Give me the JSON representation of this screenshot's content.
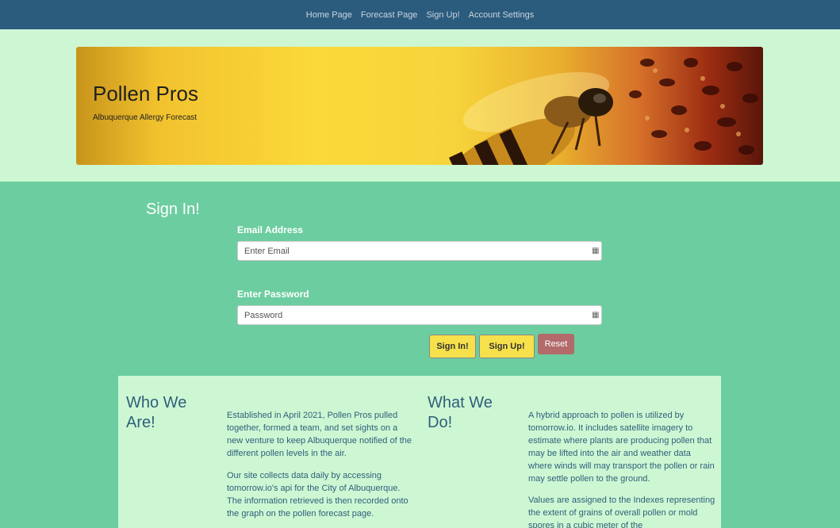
{
  "nav": {
    "home": "Home Page",
    "forecast": "Forecast Page",
    "signup": "Sign Up!",
    "account": "Account Settings"
  },
  "banner": {
    "title": "Pollen Pros",
    "subtitle": "Albuquerque Allergy Forecast"
  },
  "signin": {
    "heading": "Sign In!",
    "email_label": "Email Address",
    "email_placeholder": "Enter Email",
    "password_label": "Enter Password",
    "password_placeholder": "Password",
    "signin_button": "Sign In!",
    "signup_button": "Sign Up!",
    "reset_button": "Reset"
  },
  "about": {
    "who_heading": "Who We Are!",
    "who_p1": "Established in April 2021, Pollen Pros pulled together, formed a team, and set sights on a new venture to keep Albuquerque notified of the different pollen levels in the air.",
    "who_p2": "Our site collects data daily by accessing tomorrow.io's api for the City of Albuquerque. The information retrieved is then recorded onto the graph on the pollen forecast page.",
    "what_heading": "What We Do!",
    "what_p1": "A hybrid approach to pollen is utilized by tomorrow.io. It includes satellite imagery to estimate where plants are producing pollen that may be lifted into the air and weather data where winds will may transport the pollen or rain may settle pollen to the ground.",
    "what_p2": "Values are assigned to the Indexes representing the extent of grains of overall pollen or mold spores in a cubic meter of the"
  },
  "colors": {
    "nav_bg": "#2b5b7d",
    "hero_bg": "#cdf7d3",
    "page_bg": "#6ccda0",
    "button_yellow": "#f6e04b",
    "button_reset": "#b26a6a",
    "heading_blue": "#2f5f7a"
  },
  "icons": {
    "field_icon": "password-manager-icon"
  }
}
